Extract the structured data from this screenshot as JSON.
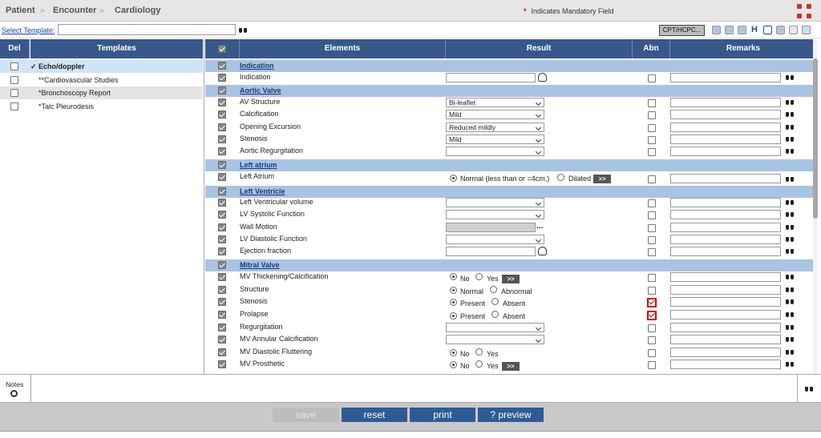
{
  "breadcrumb": {
    "patient": "Patient",
    "encounter": "Encounter",
    "cardiology": "Cardiology",
    "sep": "»"
  },
  "header": {
    "mandatory_star": "*",
    "mandatory_text": "Indicates Mandatory Field"
  },
  "template_bar": {
    "select_label": "Select Template:",
    "cpt_label": "CPT/HCPC..."
  },
  "left": {
    "headers": {
      "del": "Del",
      "templates": "Templates"
    },
    "items": [
      {
        "label": "✓ Echo/doppler"
      },
      {
        "label": "**Cardiovascular Studies"
      },
      {
        "label": "*Bronchoscopy Report"
      },
      {
        "label": "*Talc Pleurodesis"
      }
    ]
  },
  "table": {
    "headers": {
      "elements": "Elements",
      "result": "Result",
      "abn": "Abn",
      "remarks": "Remarks"
    },
    "sections": {
      "indication": "Indication",
      "aortic": "Aortic Valve",
      "left_atrium": "Left atrium",
      "left_ventricle": "Left Ventricle",
      "mitral": "Mitral Valve"
    },
    "rows": {
      "indication": "Indication",
      "av_structure": {
        "label": "AV Structure",
        "value": "Bi-leaflet"
      },
      "calcification": {
        "label": "Calcification",
        "value": "Mild"
      },
      "opening": {
        "label": "Opening Excursion",
        "value": "Reduced mildly"
      },
      "stenosis_av": {
        "label": "Stenosis",
        "value": "Mild"
      },
      "aortic_regurg": {
        "label": "Aortic Regurgitation",
        "value": ""
      },
      "left_atrium": {
        "label": "Left Atrium",
        "opt1": "Normal (less than or =4cm.)",
        "opt2": "Dilated",
        "more": ">>"
      },
      "lv_volume": "Left Ventricular volume",
      "lv_systolic": "LV Systolic Function",
      "wall_motion": {
        "label": "Wall Motion",
        "dots": "..."
      },
      "lv_diastolic": "LV Diastolic Function",
      "ejection": "Ejection fraction",
      "mv_thick": {
        "label": "MV Thickening/Calcification",
        "opt1": "No",
        "opt2": "Yes",
        "more": ">>"
      },
      "structure": {
        "label": "Structure",
        "opt1": "Normal",
        "opt2": "Abnormal"
      },
      "stenosis_mv": {
        "label": "Stenosis",
        "opt1": "Present",
        "opt2": "Absent",
        "abn": true
      },
      "prolapse": {
        "label": "Prolapse",
        "opt1": "Present",
        "opt2": "Absent",
        "abn": true
      },
      "regurg": "Regurgitation",
      "mv_annular": "MV Annular Calcification",
      "mv_diastolic": {
        "label": "MV Diastolic Fluttering",
        "opt1": "No",
        "opt2": "Yes"
      },
      "mv_prosthetic": {
        "label": "MV Prosthetic",
        "opt1": "No",
        "opt2": "Yes",
        "more": ">>"
      }
    }
  },
  "notes": {
    "label": "Notes"
  },
  "buttons": {
    "save": "save",
    "reset": "reset",
    "print": "print",
    "preview": "? preview"
  }
}
